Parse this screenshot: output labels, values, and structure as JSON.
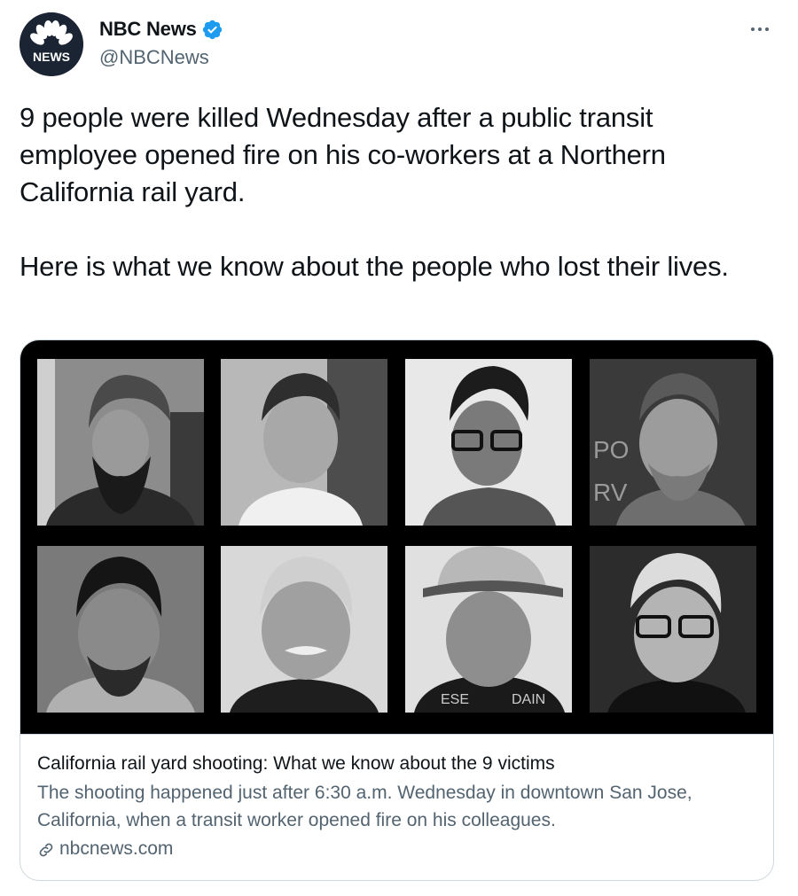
{
  "author": {
    "display_name": "NBC News",
    "handle": "@NBCNews",
    "avatar_text": "NEWS",
    "verified": true
  },
  "tweet": {
    "paragraphs": [
      "9 people were killed Wednesday after a public transit employee opened fire on his co-workers at a Northern California rail yard.",
      "Here is what we know about the people who lost their lives."
    ]
  },
  "card": {
    "title": "California rail yard shooting: What we know about the 9 victims",
    "description": "The shooting happened just after 6:30 a.m. Wednesday in downtown San Jose, California, when a transit worker opened fire on his colleagues.",
    "domain": "nbcnews.com",
    "photo_sign_text_1": "PO",
    "photo_sign_text_2": "RV",
    "photo_shirt_text_1": "ESE",
    "photo_shirt_text_2": "DAIN"
  },
  "colors": {
    "verified_blue": "#1d9bf0",
    "secondary_text": "#536471",
    "avatar_bg": "#1b2433"
  },
  "icons": {
    "verified": "verified-badge-icon",
    "more": "more-options-icon",
    "link": "link-icon"
  }
}
